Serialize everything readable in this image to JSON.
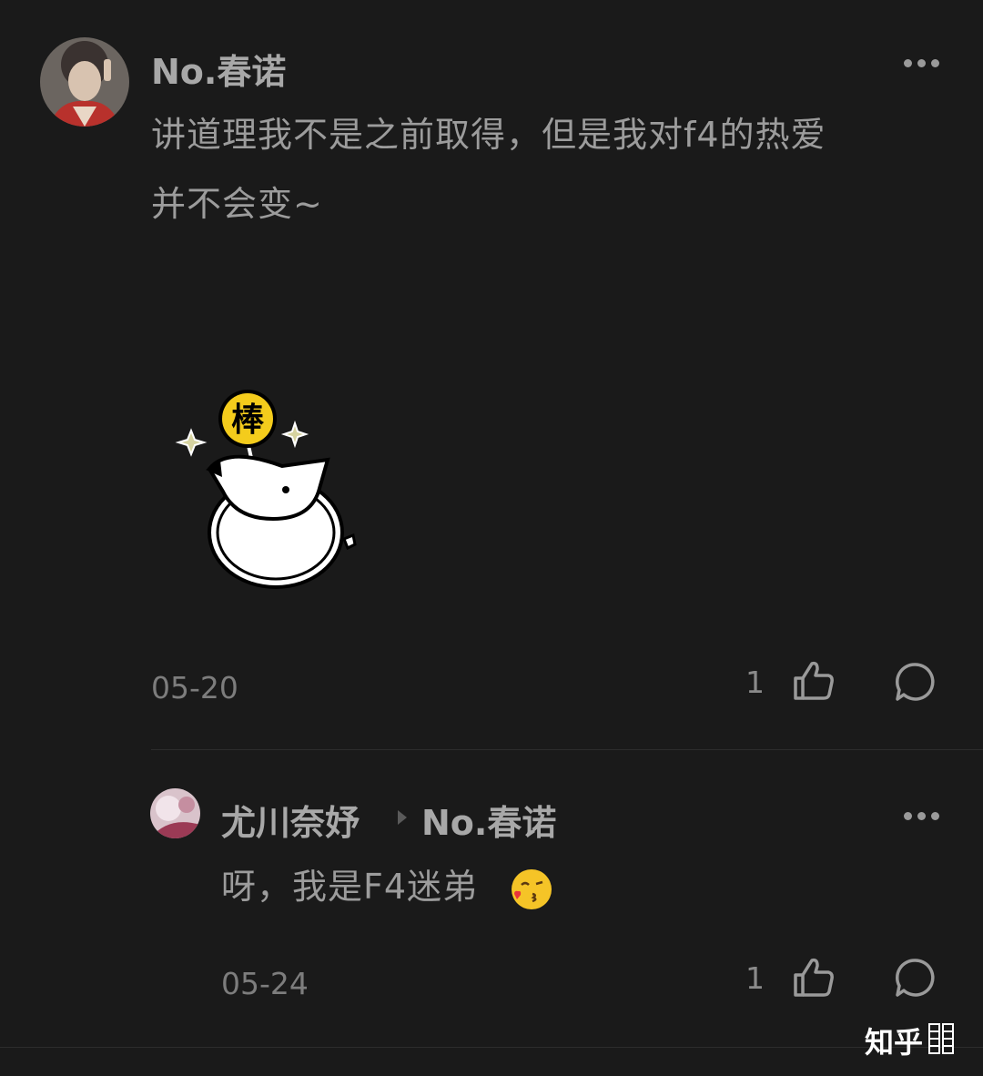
{
  "comment": {
    "author": "No.春诺",
    "text_line1": "讲道理我不是之前取得，但是我对f4的热爱",
    "text_line2": "并不会变~",
    "sticker_label": "棒",
    "date": "05-20",
    "like_count": "1"
  },
  "reply": {
    "author": "尤川奈妤",
    "reply_to": "No.春诺",
    "text": "呀，我是F4迷弟",
    "date": "05-24",
    "like_count": "1"
  },
  "watermark": "知乎"
}
